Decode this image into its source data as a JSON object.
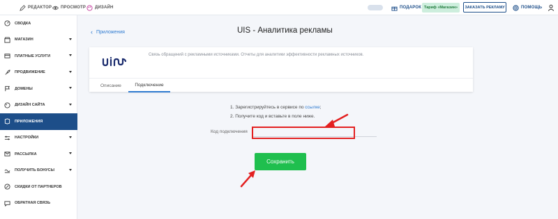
{
  "topbar": {
    "editor": "РЕДАКТОР",
    "preview": "ПРОСМОТР",
    "design": "ДИЗАЙН",
    "gifts": "ПОДАРОК",
    "tariff": "Тариф «Магазин»",
    "order_ads": "ЗАКАЗАТЬ РЕКЛАМУ",
    "help": "ПОМОЩЬ"
  },
  "sidebar": {
    "items": [
      {
        "label": "СВОДКА",
        "icon": "gauge-icon",
        "chevron": false
      },
      {
        "label": "МАГАЗИН",
        "icon": "store-icon",
        "chevron": true
      },
      {
        "label": "ПЛАТНЫЕ УСЛУГИ",
        "icon": "card-icon",
        "chevron": true
      },
      {
        "label": "ПРОДВИЖЕНИЕ",
        "icon": "rocket-icon",
        "chevron": true
      },
      {
        "label": "ДОМЕНЫ",
        "icon": "flag-icon",
        "chevron": true
      },
      {
        "label": "ДИЗАЙН САЙТА",
        "icon": "palette-icon",
        "chevron": true
      },
      {
        "label": "ПРИЛОЖЕНИЯ",
        "icon": "apps-icon",
        "chevron": false,
        "active": true
      },
      {
        "label": "НАСТРОЙКИ",
        "icon": "sliders-icon",
        "chevron": true
      },
      {
        "label": "РАССЫЛКА",
        "icon": "mail-icon",
        "chevron": true
      },
      {
        "label": "ПОЛУЧИТЬ БОНУСЫ",
        "icon": "bonus-icon",
        "chevron": true
      },
      {
        "label": "СКИДКИ ОТ ПАРТНЕРОВ",
        "icon": "percent-icon",
        "chevron": false
      },
      {
        "label": "ОБРАТНАЯ СВЯЗЬ",
        "icon": "chat-icon",
        "chevron": false
      }
    ]
  },
  "main": {
    "back": "Приложения",
    "title": "UIS - Аналитика рекламы",
    "description": "Связь обращений с рекламными источниками. Отчеты для аналитики эффективности рекламных источников.",
    "tabs": [
      "Описание",
      "Подключение"
    ],
    "step1_text": "1. Зарегистрируйтесь в сервисе по ",
    "step1_link": "ссылке",
    "step1_end": ";",
    "step2": "2. Получите код и вставьте в поле ниже.",
    "field_label": "Код подключения",
    "field_value": "",
    "save": "Сохранить"
  },
  "colors": {
    "accent": "#1d4e89",
    "link": "#2f7bd0",
    "save": "#1fbf4e",
    "annotation": "#e32020"
  }
}
